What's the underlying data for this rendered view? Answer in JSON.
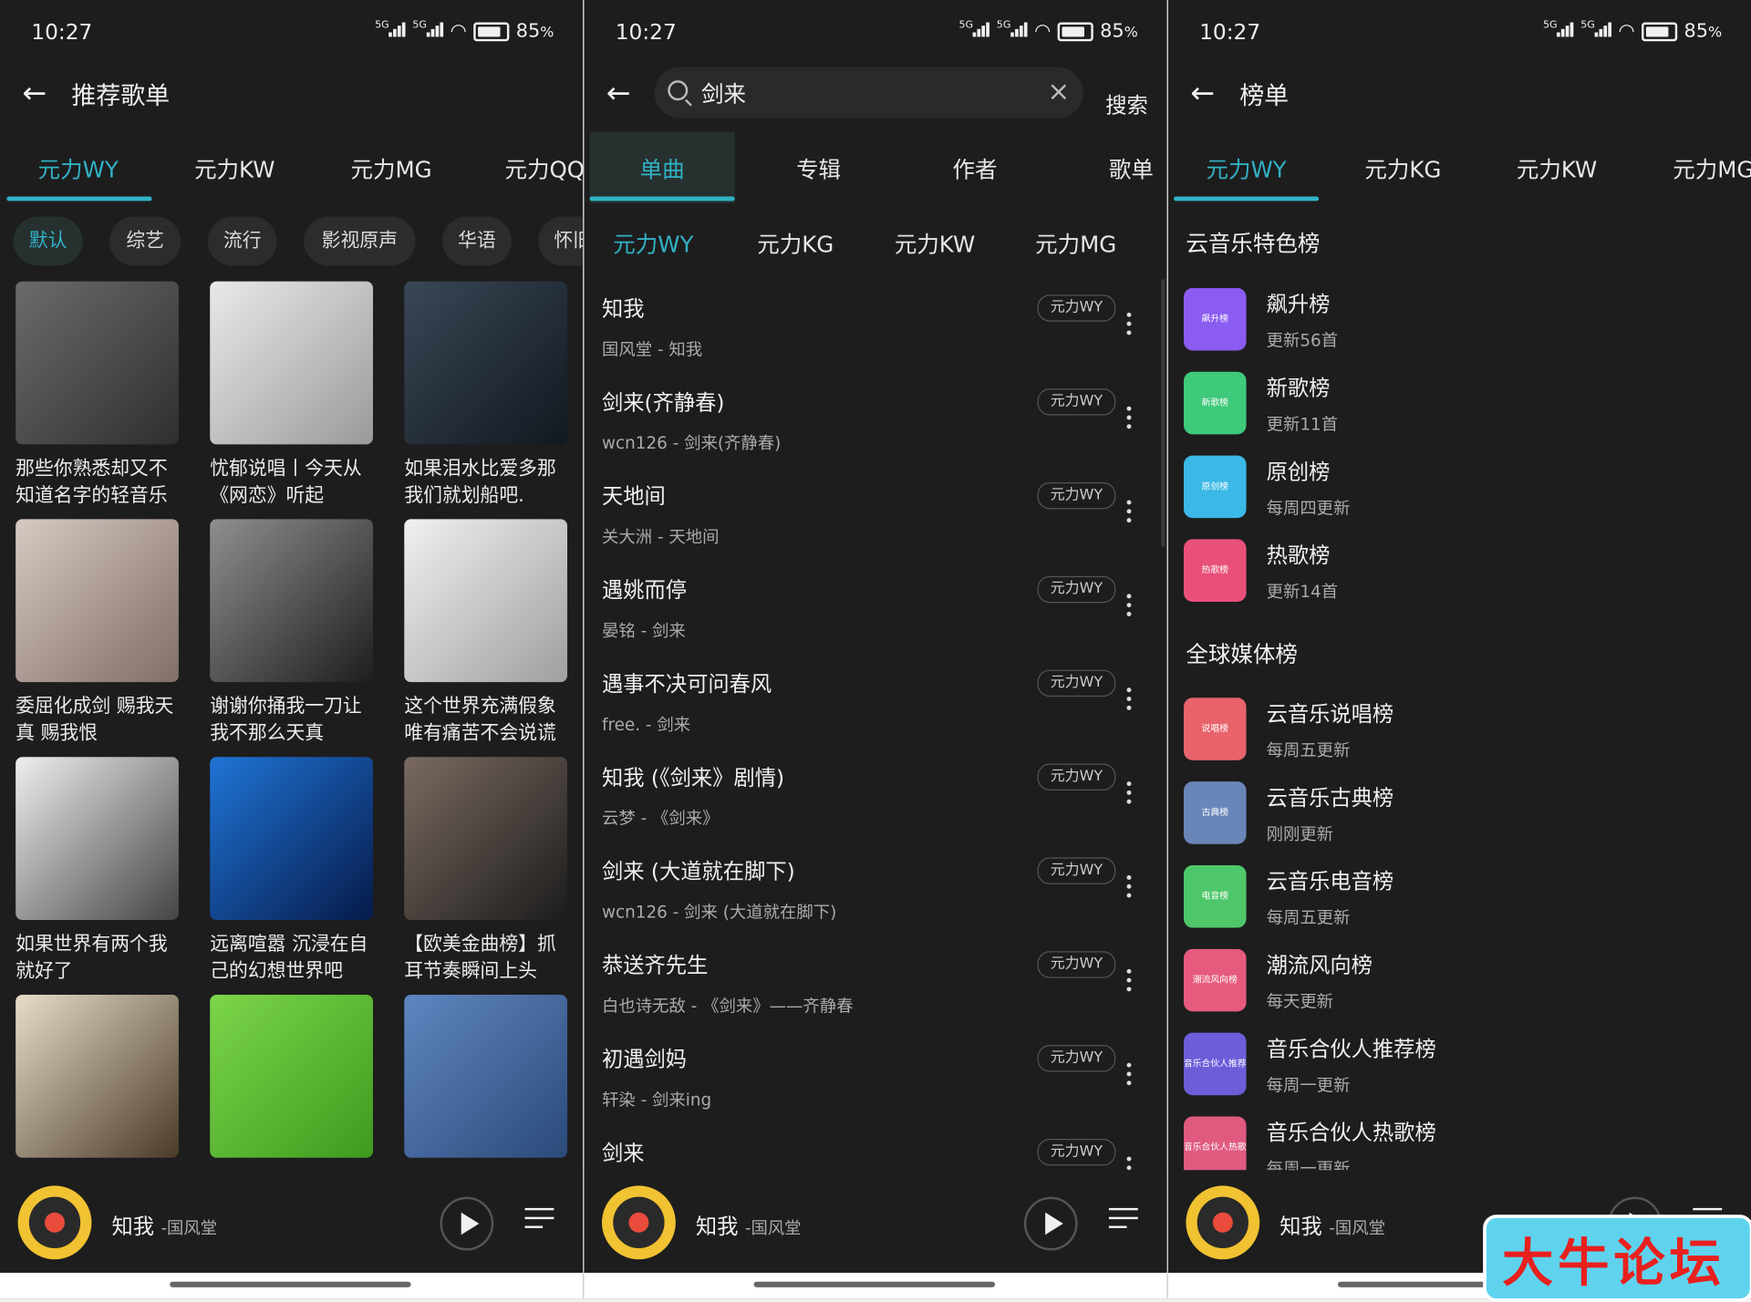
{
  "status": {
    "time": "10:27",
    "battery": "85",
    "battery_unit": "%",
    "net1": "5G",
    "net2": "5G"
  },
  "panel1": {
    "title": "推荐歌单",
    "tabs": [
      "元力WY",
      "元力KW",
      "元力MG",
      "元力QQ"
    ],
    "chips": [
      "默认",
      "综艺",
      "流行",
      "影视原声",
      "华语",
      "怀旧"
    ],
    "cards": [
      {
        "caption": "那些你熟悉却又不知道名字的轻音乐",
        "colors": [
          "#6b6b6b",
          "#2f2f2f"
        ]
      },
      {
        "caption": "忧郁说唱丨今天从《网恋》听起",
        "colors": [
          "#e9e9e9",
          "#9a9a9a"
        ]
      },
      {
        "caption": "如果泪水比爱多那我们就划船吧.",
        "colors": [
          "#3a4756",
          "#111820"
        ]
      },
      {
        "caption": "委屈化成剑 赐我天真 赐我恨",
        "colors": [
          "#d8c9c3",
          "#806e68"
        ]
      },
      {
        "caption": "谢谢你捅我一刀让我不那么天真",
        "colors": [
          "#8f8f8f",
          "#1e1e1e"
        ]
      },
      {
        "caption": "这个世界充满假象唯有痛苦不会说谎",
        "colors": [
          "#f0f0f0",
          "#9f9f9f"
        ]
      },
      {
        "caption": "如果世界有两个我就好了",
        "colors": [
          "#efefef",
          "#444444"
        ]
      },
      {
        "caption": "远离喧嚣 沉浸在自己的幻想世界吧",
        "colors": [
          "#1f74d6",
          "#061a4a"
        ]
      },
      {
        "caption": "【欧美金曲榜】抓耳节奏瞬间上头",
        "colors": [
          "#7a6a60",
          "#1c1c1c"
        ]
      },
      {
        "caption": "",
        "colors": [
          "#e8dcc8",
          "#4a3a2a"
        ]
      },
      {
        "caption": "",
        "colors": [
          "#7bd64a",
          "#3e9a1e"
        ]
      },
      {
        "caption": "",
        "colors": [
          "#5f86c0",
          "#2b4a7a"
        ]
      }
    ]
  },
  "panel2": {
    "search_value": "剑来",
    "search_button": "搜索",
    "type_tabs": [
      "单曲",
      "专辑",
      "作者",
      "歌单"
    ],
    "source_tabs": [
      "元力WY",
      "元力KG",
      "元力KW",
      "元力MG"
    ],
    "songs": [
      {
        "title": "知我",
        "sub": "国风堂 - 知我",
        "tag": "元力WY"
      },
      {
        "title": "剑来(齐静春)",
        "sub": "wcn126 - 剑来(齐静春)",
        "tag": "元力WY"
      },
      {
        "title": "天地间",
        "sub": "关大洲 - 天地间",
        "tag": "元力WY"
      },
      {
        "title": "遇姚而停",
        "sub": "晏铭 - 剑来",
        "tag": "元力WY"
      },
      {
        "title": "遇事不决可问春风",
        "sub": "free. - 剑来",
        "tag": "元力WY"
      },
      {
        "title": "知我 (《剑来》剧情)",
        "sub": "云梦 - 《剑来》",
        "tag": "元力WY"
      },
      {
        "title": "剑来 (大道就在脚下)",
        "sub": "wcn126 - 剑来 (大道就在脚下)",
        "tag": "元力WY"
      },
      {
        "title": "恭送齐先生",
        "sub": "白也诗无敌 - 《剑来》——齐静春",
        "tag": "元力WY"
      },
      {
        "title": "初遇剑妈",
        "sub": "轩染 - 剑来ing",
        "tag": "元力WY"
      },
      {
        "title": "剑来",
        "sub": "",
        "tag": "元力WY"
      }
    ]
  },
  "panel3": {
    "title": "榜单",
    "tabs": [
      "元力WY",
      "元力KG",
      "元力KW",
      "元力MG"
    ],
    "section1": "云音乐特色榜",
    "section2": "全球媒体榜",
    "charts1": [
      {
        "name": "飙升榜",
        "sub": "更新56首",
        "icon_text": "飙升榜",
        "color": "#8a5cf0"
      },
      {
        "name": "新歌榜",
        "sub": "更新11首",
        "icon_text": "新歌榜",
        "color": "#3fc97a"
      },
      {
        "name": "原创榜",
        "sub": "每周四更新",
        "icon_text": "原创榜",
        "color": "#3bb8e6"
      },
      {
        "name": "热歌榜",
        "sub": "更新14首",
        "icon_text": "热歌榜",
        "color": "#e8507a"
      }
    ],
    "charts2": [
      {
        "name": "云音乐说唱榜",
        "sub": "每周五更新",
        "icon_text": "说唱榜",
        "color": "#e8636b"
      },
      {
        "name": "云音乐古典榜",
        "sub": "刚刚更新",
        "icon_text": "古典榜",
        "color": "#6a86b8"
      },
      {
        "name": "云音乐电音榜",
        "sub": "每周五更新",
        "icon_text": "电音榜",
        "color": "#4ec76a"
      },
      {
        "name": "潮流风向榜",
        "sub": "每天更新",
        "icon_text": "潮流风向榜",
        "color": "#e65a7e"
      },
      {
        "name": "音乐合伙人推荐榜",
        "sub": "每周一更新",
        "icon_text": "音乐合伙人推荐榜",
        "color": "#6b5ed8"
      },
      {
        "name": "音乐合伙人热歌榜",
        "sub": "每周一更新",
        "icon_text": "音乐合伙人热歌榜",
        "color": "#e05a80"
      }
    ]
  },
  "player": {
    "title": "知我",
    "artist": "-国风堂"
  },
  "watermark": "大牛论坛",
  "colors": {
    "accent": "#31b2c6",
    "background": "#1d1d1d"
  }
}
